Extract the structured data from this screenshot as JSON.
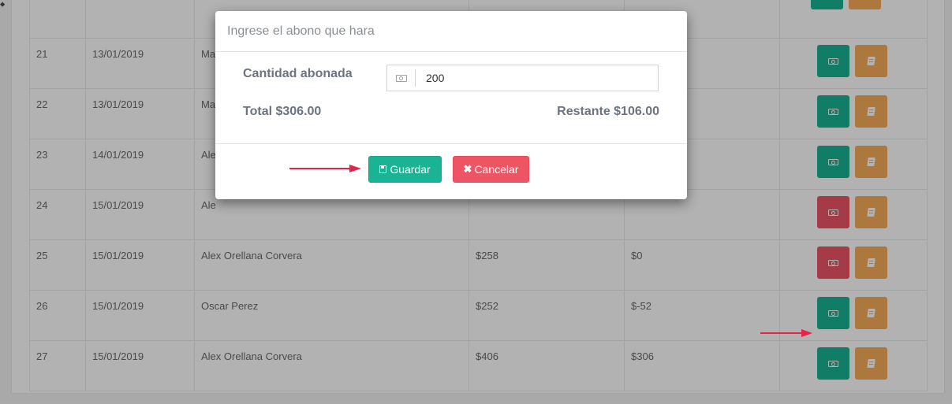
{
  "table": {
    "rows": [
      {
        "id": "",
        "date": "",
        "name": "",
        "total": "",
        "rest": "",
        "pay_color": "green"
      },
      {
        "id": "21",
        "date": "13/01/2019",
        "name": "Ma",
        "total": "",
        "rest": "",
        "pay_color": "green"
      },
      {
        "id": "22",
        "date": "13/01/2019",
        "name": "Ma",
        "total": "",
        "rest": "",
        "pay_color": "green"
      },
      {
        "id": "23",
        "date": "14/01/2019",
        "name": "Ale",
        "total": "",
        "rest": "",
        "pay_color": "green"
      },
      {
        "id": "24",
        "date": "15/01/2019",
        "name": "Ale",
        "total": "",
        "rest": "",
        "pay_color": "red"
      },
      {
        "id": "25",
        "date": "15/01/2019",
        "name": "Alex Orellana Corvera",
        "total": "$258",
        "rest": "$0",
        "pay_color": "red"
      },
      {
        "id": "26",
        "date": "15/01/2019",
        "name": "Oscar Perez",
        "total": "$252",
        "rest": "$-52",
        "pay_color": "green"
      },
      {
        "id": "27",
        "date": "15/01/2019",
        "name": "Alex Orellana Corvera",
        "total": "$406",
        "rest": "$306",
        "pay_color": "green"
      }
    ],
    "pay_icon": "money-icon",
    "detail_icon": "book-icon"
  },
  "modal": {
    "title": "Ingrese el abono que hara",
    "amount_label": "Cantidad abonada",
    "amount_value": "200",
    "amount_icon": "money-icon",
    "total_text": "Total $306.00",
    "remaining_text": "Restante $106.00",
    "save_label": "Guardar",
    "save_icon": "floppy-disk-icon",
    "cancel_label": "Cancelar",
    "cancel_icon": "times-icon"
  },
  "colors": {
    "green": "#1ab394",
    "red": "#ed5565",
    "orange": "#f8ac59",
    "annotation_arrow": "#e8234a"
  }
}
